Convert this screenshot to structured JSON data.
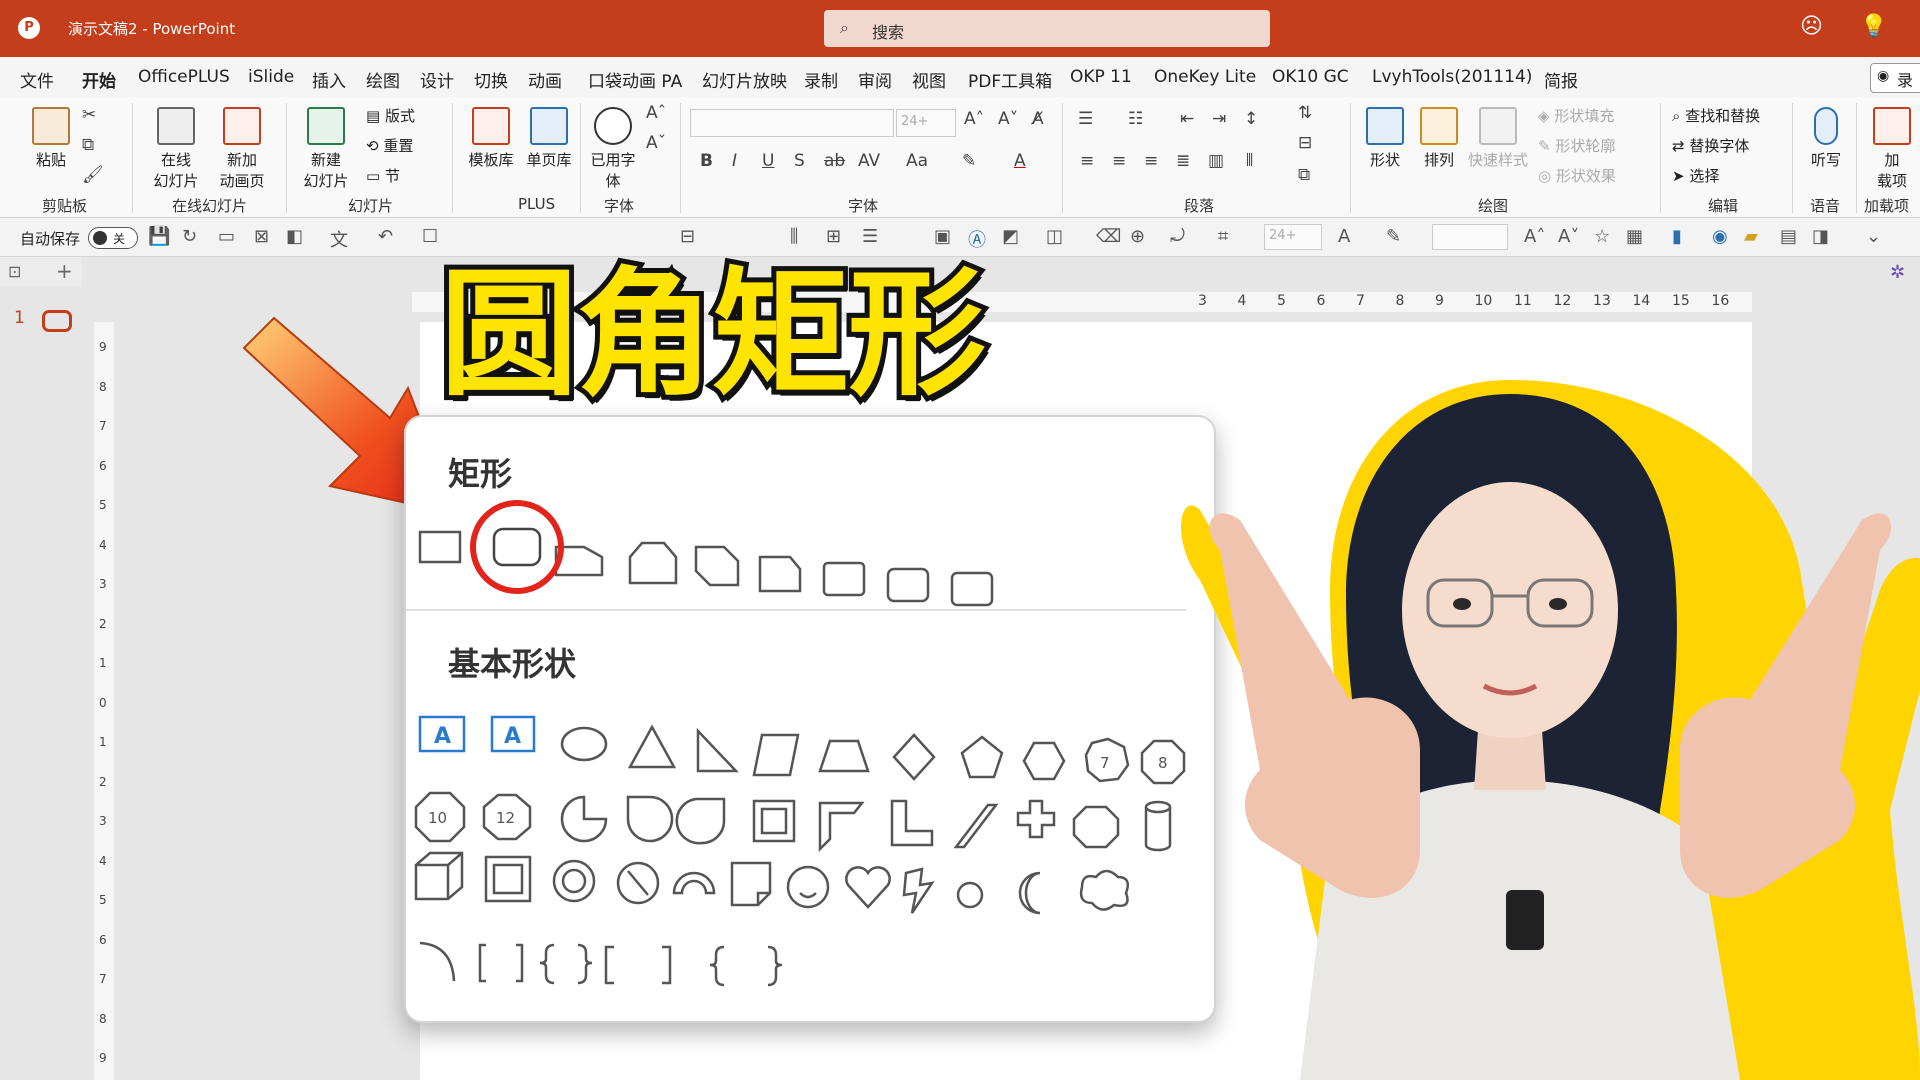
{
  "window": {
    "title": "演示文稿2  -  PowerPoint",
    "search_placeholder": "搜索",
    "search_icon": "search-icon",
    "app_icon": "powerpoint-icon",
    "app_icon_letter": "P"
  },
  "menu": {
    "tabs": [
      "文件",
      "开始",
      "OfficePLUS",
      "iSlide",
      "插入",
      "绘图",
      "设计",
      "切换",
      "动画",
      "口袋动画 PA",
      "幻灯片放映",
      "录制",
      "审阅",
      "视图",
      "PDF工具箱",
      "OKP 11",
      "OneKey Lite",
      "OK10 GC",
      "LvyhTools(201114)",
      "简报"
    ],
    "active_tab": "开始",
    "record_label": "录"
  },
  "ribbon": {
    "groups": {
      "clipboard": "剪贴板",
      "online_slides": "在线幻灯片",
      "slides": "幻灯片",
      "plus": "PLUS",
      "font_small": "字体",
      "font": "字体",
      "paragraph": "段落",
      "drawing": "绘图",
      "editing": "编辑",
      "voice": "语音",
      "addins": "加载项"
    },
    "buttons": {
      "paste": "粘贴",
      "online_slide_1": "在线",
      "online_slide_2": "幻灯片",
      "new_anim_1": "新加",
      "new_anim_2": "动画页",
      "new_slide_1": "新建",
      "new_slide_2": "幻灯片",
      "layout": "版式",
      "reset": "重置",
      "section": "节",
      "template_lib": "模板库",
      "single_page_lib": "单页库",
      "used_font_1": "已用字",
      "used_font_2": "体",
      "font_size": "24+",
      "shapes": "形状",
      "arrange": "排列",
      "quick_styles": "快速样式",
      "shape_fill": "形状填充",
      "shape_outline": "形状轮廓",
      "shape_effects": "形状效果",
      "find_replace": "查找和替换",
      "replace_font": "替换字体",
      "select": "选择",
      "dictate": "听写",
      "addins_1": "加",
      "addins_2": "载项"
    }
  },
  "qat": {
    "autosave_label": "自动保存",
    "autosave_state": "关",
    "font_size_box": "24+"
  },
  "slides_panel": {
    "slide_number": "1"
  },
  "ruler": {
    "h_ticks": [
      "3",
      "4",
      "5",
      "6",
      "7",
      "8",
      "9",
      "10",
      "11",
      "12",
      "13",
      "14",
      "15",
      "16"
    ],
    "v_ticks": [
      "9",
      "8",
      "7",
      "6",
      "5",
      "4",
      "3",
      "2",
      "1",
      "0",
      "1",
      "2",
      "3",
      "4",
      "5",
      "6",
      "7",
      "8",
      "9"
    ]
  },
  "overlay": {
    "title": "圆角矩形"
  },
  "shapes_panel": {
    "rect_header": "矩形",
    "basic_header": "基本形状",
    "highlighted_shape": "rounded-rectangle",
    "highlight_color": "#e3241b",
    "arrow_color": "#f0501e",
    "octagon_labels": [
      "7",
      "8",
      "10",
      "12"
    ]
  },
  "colors": {
    "titlebar": "#c43e1c",
    "title_fill": "#ffe400",
    "title_stroke": "#111111"
  }
}
